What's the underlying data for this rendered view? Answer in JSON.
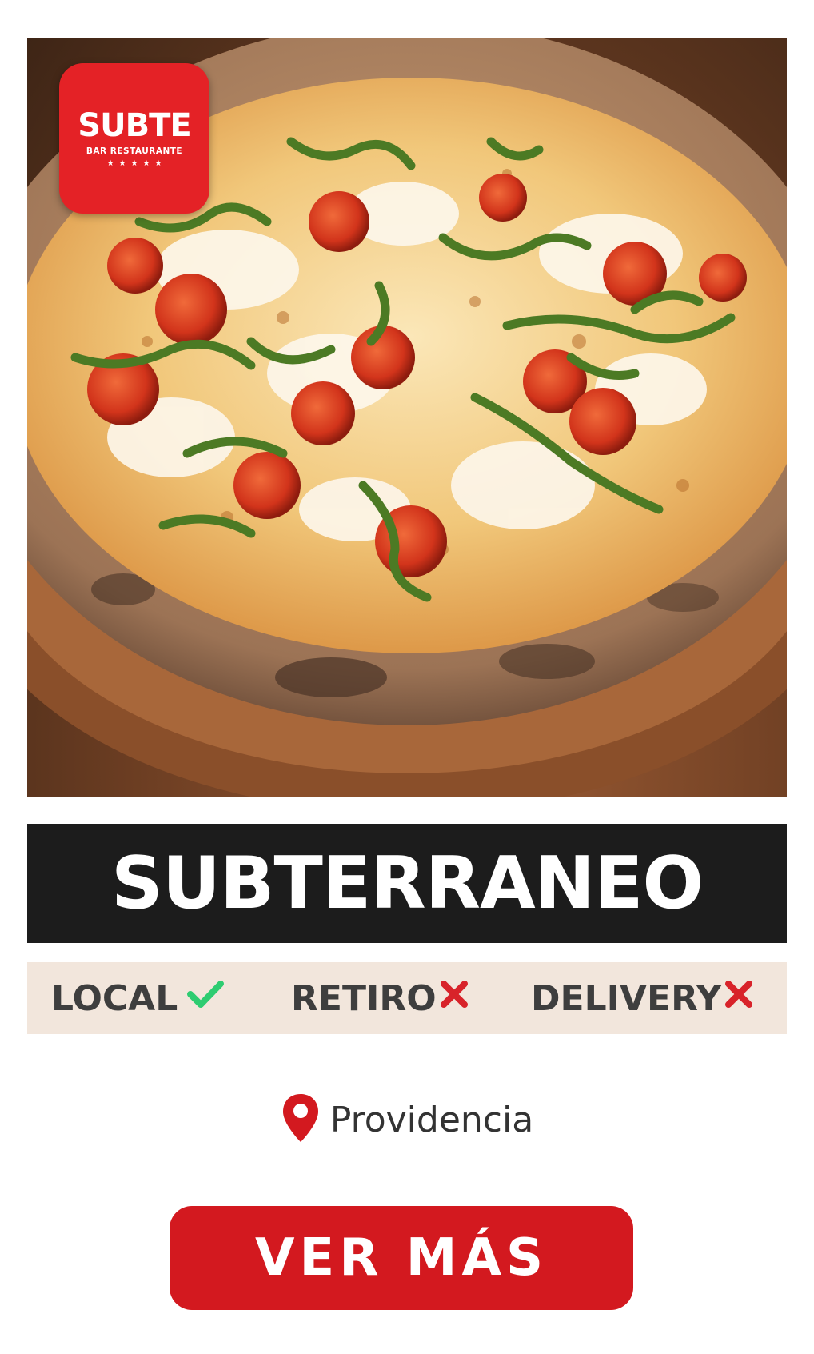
{
  "logo": {
    "name": "SUBTE",
    "subtitle": "BAR  RESTAURANTE",
    "stars": "★★★★★"
  },
  "restaurant": {
    "name": "SUBTERRANEO"
  },
  "services": [
    {
      "label": "LOCAL",
      "available": true,
      "icon": "check-icon"
    },
    {
      "label": "RETIRO",
      "available": false,
      "icon": "cross-icon"
    },
    {
      "label": "DELIVERY",
      "available": false,
      "icon": "cross-icon"
    }
  ],
  "location": {
    "icon": "location-pin-icon",
    "text": "Providencia"
  },
  "cta": {
    "label": "VER MÁS"
  },
  "colors": {
    "brand_red": "#e42226",
    "button_red": "#d3191f",
    "check_green": "#2ecc71",
    "cross_red": "#d8232a",
    "name_bar": "#1c1c1c",
    "options_bg": "#f2e6dc"
  }
}
